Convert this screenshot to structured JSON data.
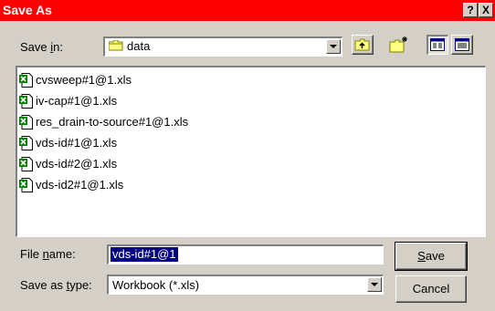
{
  "window": {
    "title": "Save As",
    "help_button": "?",
    "close_button": "X"
  },
  "save_in": {
    "label_pre": "Save ",
    "label_accel": "i",
    "label_post": "n:",
    "value": "data",
    "icon": "folder-icon"
  },
  "toolbar": {
    "buttons": [
      {
        "name": "up-one-level",
        "icon": "folder-up-icon"
      },
      {
        "name": "create-new-folder",
        "icon": "new-folder-icon"
      },
      {
        "name": "list-view",
        "icon": "list-view-icon"
      },
      {
        "name": "details-view",
        "icon": "details-view-icon"
      }
    ]
  },
  "files": [
    "cvsweep#1@1.xls",
    "iv-cap#1@1.xls",
    "res_drain-to-source#1@1.xls",
    "vds-id#1@1.xls",
    "vds-id#2@1.xls",
    "vds-id2#1@1.xls"
  ],
  "file_name": {
    "label_pre": "File ",
    "label_accel": "n",
    "label_post": "ame:",
    "value": "vds-id#1@1"
  },
  "save_as_type": {
    "label_pre": "Save as ",
    "label_accel": "t",
    "label_post": "ype:",
    "value": "Workbook (*.xls)"
  },
  "buttons": {
    "save_accel": "S",
    "save_rest": "ave",
    "cancel": "Cancel"
  },
  "colors": {
    "titlebar": "#ff0000",
    "dialog_bg": "#d4d0c8",
    "selection": "#000080"
  }
}
